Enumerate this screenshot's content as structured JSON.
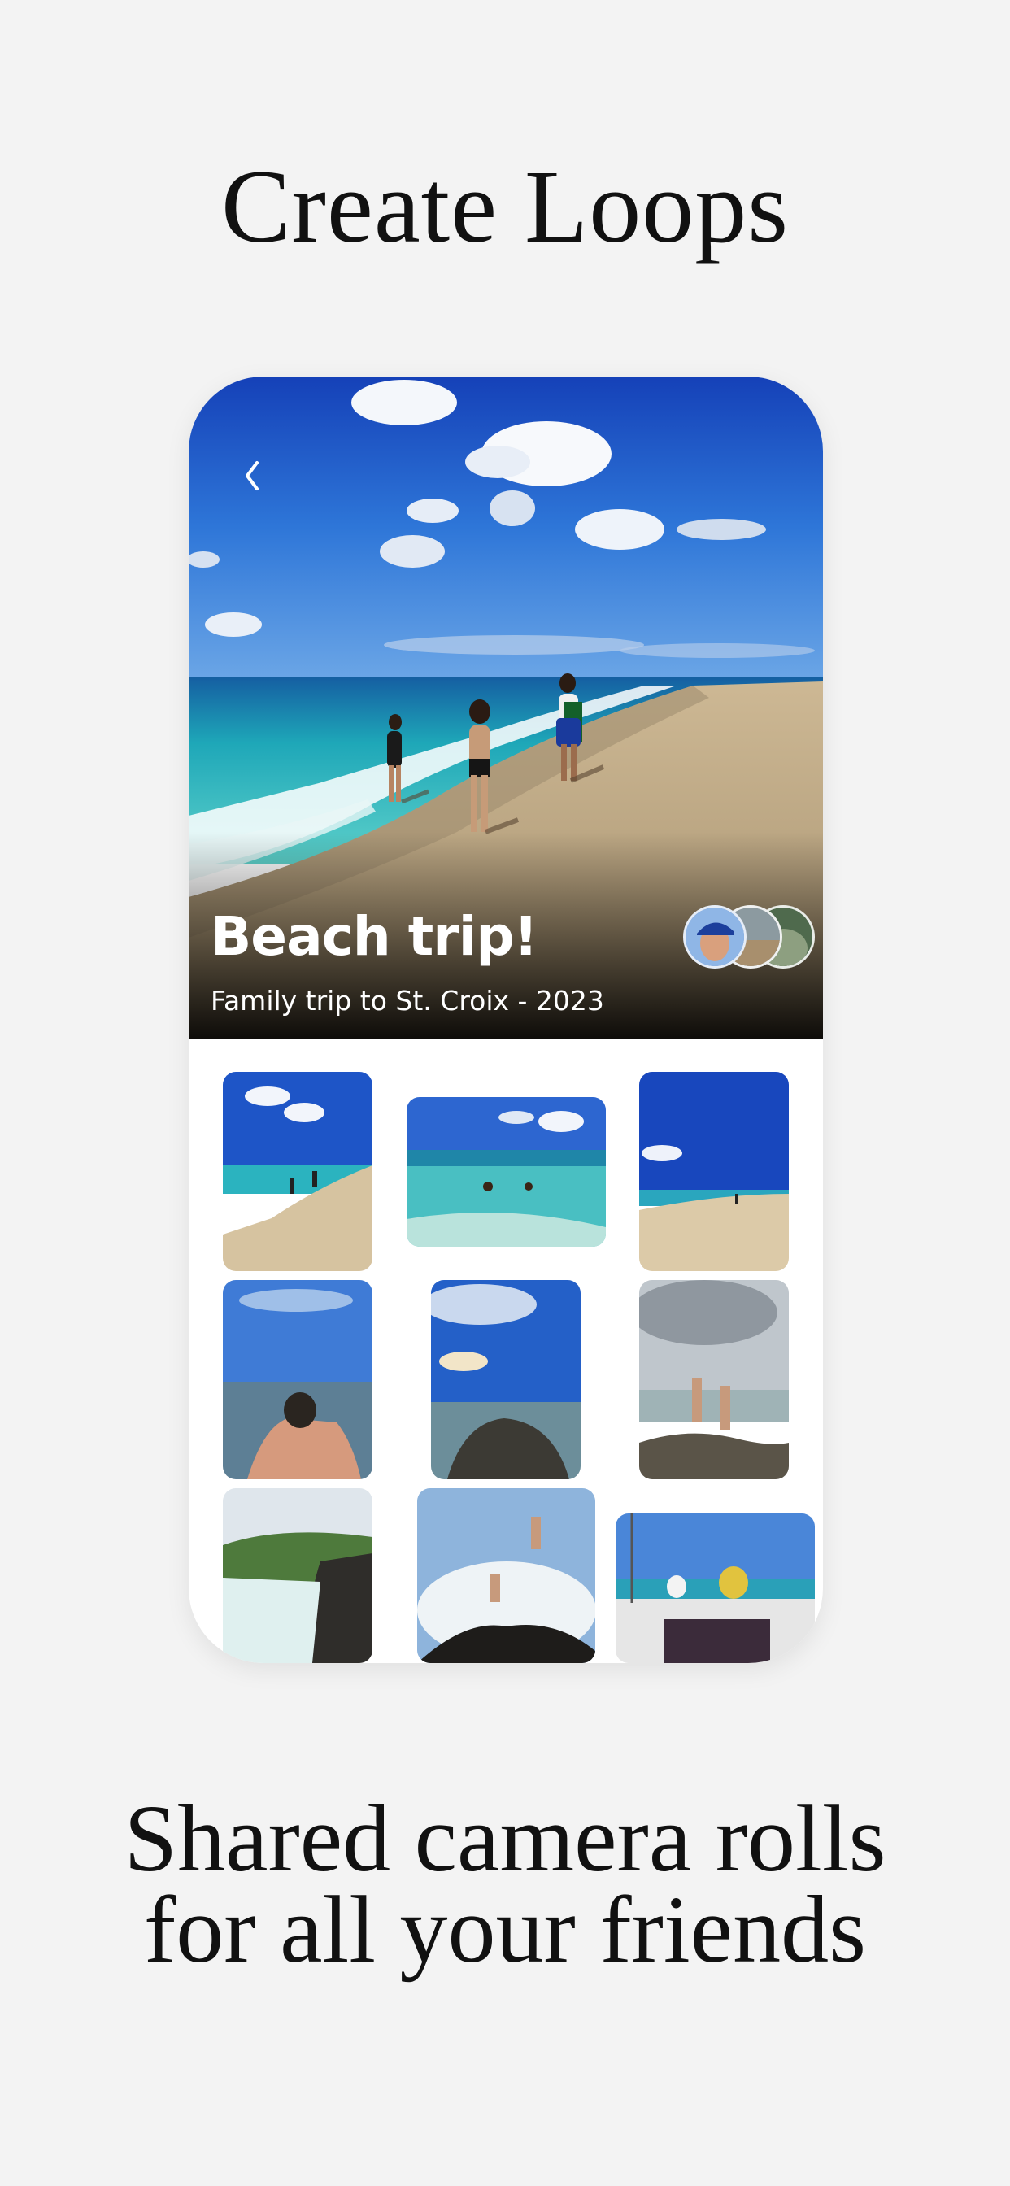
{
  "headline": "Create Loops",
  "album": {
    "title": "Beach trip!",
    "subtitle": "Family trip to St. Croix - 2023",
    "back_icon": "chevron-left-icon",
    "member_avatars": [
      "person-in-blue-cap",
      "beach-scene",
      "rocky-shore"
    ]
  },
  "photos": [
    "beach-walkers",
    "swimmers-in-surf",
    "empty-beach",
    "hand-holding-shell",
    "rocky-shoreline",
    "boys-on-rocks",
    "green-cliffs",
    "jump-into-waves",
    "sailboat-deck"
  ],
  "caption": {
    "line1": "Shared camera rolls",
    "line2": "for all your friends"
  },
  "colors": {
    "background": "#f3f3f3",
    "sky": "#1f5fd1",
    "sea": "#23b9c0",
    "sand": "#d9c6a5"
  }
}
